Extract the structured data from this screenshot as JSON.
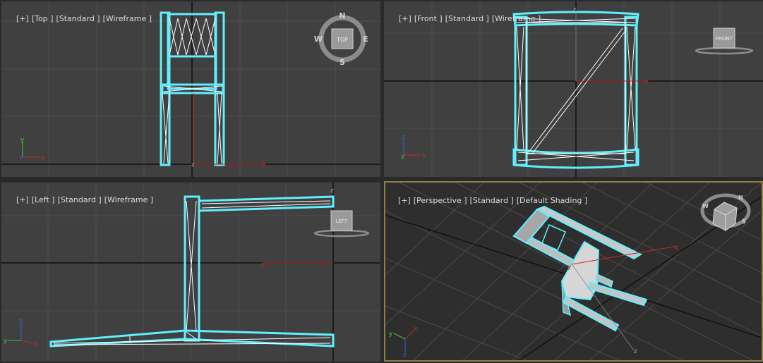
{
  "viewports": {
    "top": {
      "labels": [
        "[+]",
        "[Top ]",
        "[Standard ]",
        "[Wireframe ]"
      ]
    },
    "front": {
      "labels": [
        "[+]",
        "[Front ]",
        "[Standard ]",
        "[Wireframe ]"
      ]
    },
    "left": {
      "labels": [
        "[+]",
        "[Left ]",
        "[Standard ]",
        "[Wireframe ]"
      ]
    },
    "perspective": {
      "labels": [
        "[+]",
        "[Perspective ]",
        "[Standard ]",
        "[Default Shading ]"
      ]
    }
  },
  "viewcube": {
    "top": {
      "face": "TOP",
      "north": "N",
      "south": "S",
      "east": "E",
      "west": "W"
    },
    "front": {
      "face": "FRONT"
    },
    "left": {
      "face": "LEFT"
    },
    "persp": {
      "n": "N",
      "s": "S",
      "w": "W"
    }
  },
  "axes": {
    "x": "x",
    "y": "y",
    "z": "z"
  },
  "colors": {
    "viewport_bg": "#404040",
    "persp_bg": "#2e2e2e",
    "grid": "#4d4d4d",
    "grid_major": "#111111",
    "selection": "#5ff0ff",
    "wire": "#ffffff",
    "active_border": "#8f7d46",
    "axis_x": "#c82828",
    "axis_y": "#3dc83d",
    "axis_z": "#3b5be0"
  }
}
